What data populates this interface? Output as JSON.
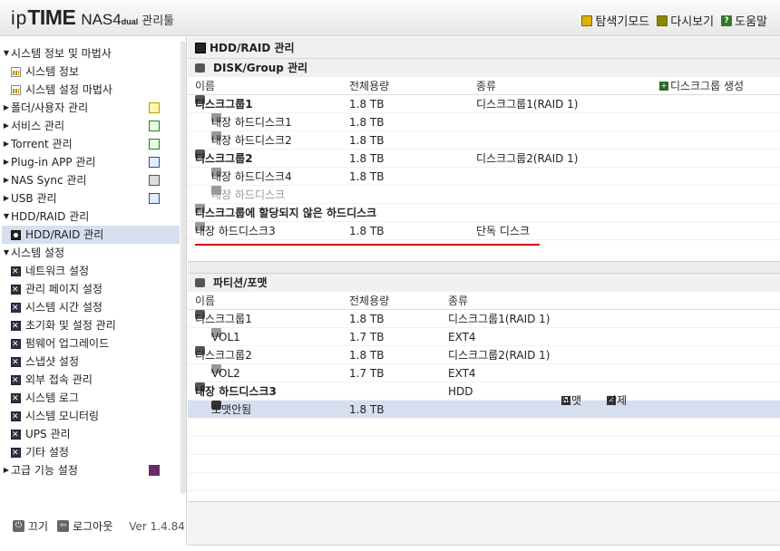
{
  "header": {
    "logo_ip": "ip",
    "logo_time": "TIME",
    "logo_nas": "NAS4",
    "logo_dual": "dual",
    "logo_mgr": "관리툴",
    "links": [
      {
        "label": "탐색기모드",
        "icon": "explorer-icon",
        "color": "#d4a000"
      },
      {
        "label": "다시보기",
        "icon": "refresh-icon",
        "color": "#8a8a00"
      },
      {
        "label": "도움말",
        "icon": "help-icon",
        "color": "#2a7a2a"
      }
    ]
  },
  "sidebar": {
    "items": [
      {
        "label": "시스템 정보 및 마법사",
        "type": "open"
      },
      {
        "label": "시스템 정보",
        "type": "child",
        "icon": "chart-icon"
      },
      {
        "label": "시스템 설정 마법사",
        "type": "child",
        "icon": "chart-icon"
      },
      {
        "label": "폴더/사용자 관리",
        "type": "closed",
        "right_icon": "folder-user-icon"
      },
      {
        "label": "서비스 관리",
        "type": "closed",
        "right_icon": "service-icon"
      },
      {
        "label": "Torrent 관리",
        "type": "closed",
        "right_icon": "torrent-icon"
      },
      {
        "label": "Plug-in APP 관리",
        "type": "closed",
        "right_icon": "plugin-icon"
      },
      {
        "label": "NAS Sync 관리",
        "type": "closed",
        "right_icon": "sync-icon"
      },
      {
        "label": "USB 관리",
        "type": "closed",
        "right_icon": "usb-icon"
      },
      {
        "label": "HDD/RAID 관리",
        "type": "open"
      },
      {
        "label": "HDD/RAID 관리",
        "type": "child-selected",
        "icon": "hdd-raid-icon"
      },
      {
        "label": "시스템 설정",
        "type": "open"
      },
      {
        "label": "네트워크 설정",
        "type": "child",
        "icon": "settings-icon"
      },
      {
        "label": "관리 페이지 설정",
        "type": "child",
        "icon": "settings-icon"
      },
      {
        "label": "시스템 시간 설정",
        "type": "child",
        "icon": "settings-icon"
      },
      {
        "label": "초기화 및 설정 관리",
        "type": "child",
        "icon": "settings-icon"
      },
      {
        "label": "펌웨어 업그레이드",
        "type": "child",
        "icon": "settings-icon"
      },
      {
        "label": "스냅샷 설정",
        "type": "child",
        "icon": "settings-icon"
      },
      {
        "label": "외부 접속 관리",
        "type": "child",
        "icon": "settings-icon"
      },
      {
        "label": "시스템 로그",
        "type": "child",
        "icon": "settings-icon"
      },
      {
        "label": "시스템 모니터링",
        "type": "child",
        "icon": "settings-icon"
      },
      {
        "label": "UPS 관리",
        "type": "child",
        "icon": "settings-icon"
      },
      {
        "label": "기타 설정",
        "type": "child",
        "icon": "settings-icon"
      },
      {
        "label": "고급 기능 설정",
        "type": "closed",
        "right_icon": "advanced-icon"
      }
    ],
    "bottom": {
      "power": "끄기",
      "logout": "로그아웃",
      "version": "Ver 1.4.84"
    }
  },
  "main": {
    "title": "HDD/RAID 관리",
    "disk": {
      "title": "DISK/Group 관리",
      "col_name": "이름",
      "col_size": "전체용량",
      "col_type": "종류",
      "create": "디스크그룹 생성",
      "rows": [
        {
          "name": "디스크그룹1",
          "size": "1.8 TB",
          "type": "디스크그룹1(RAID 1)",
          "kind": "group"
        },
        {
          "name": "내장 하드디스크1",
          "size": "1.8 TB",
          "type": "",
          "kind": "disk"
        },
        {
          "name": "내장 하드디스크2",
          "size": "1.8 TB",
          "type": "",
          "kind": "disk"
        },
        {
          "name": "디스크그룹2",
          "size": "1.8 TB",
          "type": "디스크그룹2(RAID 1)",
          "kind": "group"
        },
        {
          "name": "내장 하드디스크4",
          "size": "1.8 TB",
          "type": "",
          "kind": "disk"
        },
        {
          "name": "내장 하드디스크",
          "size": "",
          "type": "",
          "kind": "disk-grey"
        },
        {
          "name": "디스크그룹에 할당되지 않은 하드디스크",
          "size": "",
          "type": "",
          "kind": "unassigned"
        },
        {
          "name": "내장 하드디스크3",
          "size": "1.8 TB",
          "type": "단독 디스크",
          "kind": "disk"
        }
      ]
    },
    "partition": {
      "title": "파티션/포맷",
      "col_name": "이름",
      "col_size": "전체용량",
      "col_type": "종류",
      "rows": [
        {
          "name": "디스크그룹1",
          "size": "1.8 TB",
          "type": "디스크그룹1(RAID 1)",
          "kind": "group"
        },
        {
          "name": "VOL1",
          "size": "1.7 TB",
          "type": "EXT4",
          "kind": "vol"
        },
        {
          "name": "디스크그룹2",
          "size": "1.8 TB",
          "type": "디스크그룹2(RAID 1)",
          "kind": "group"
        },
        {
          "name": "VOL2",
          "size": "1.7 TB",
          "type": "EXT4",
          "kind": "vol"
        },
        {
          "name": "내장 하드디스크3",
          "size": "",
          "type": "HDD",
          "kind": "group-b"
        },
        {
          "name": "포맷안됨",
          "size": "1.8 TB",
          "type": "",
          "kind": "unformatted"
        }
      ],
      "format": "포맷",
      "delete": "삭제"
    }
  }
}
